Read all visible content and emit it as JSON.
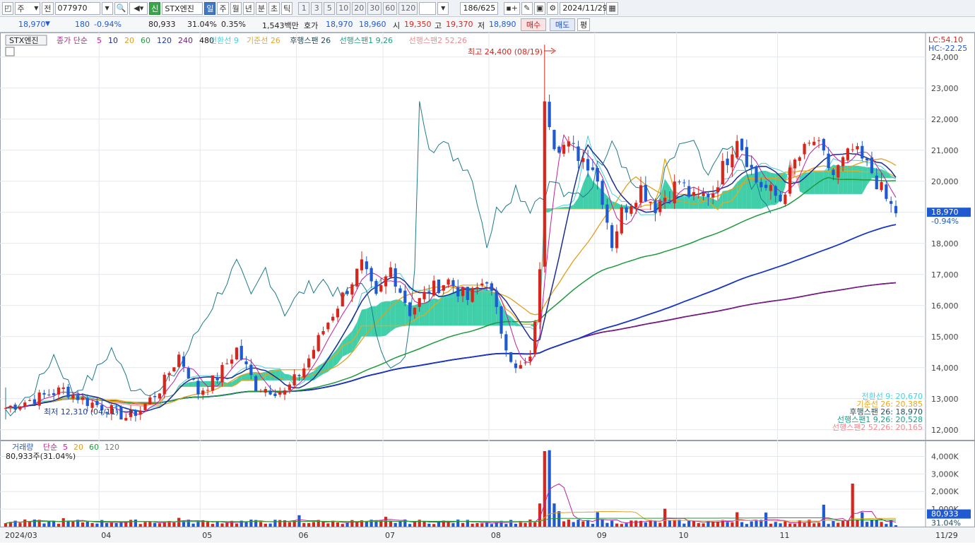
{
  "toolbar": {
    "type_select": "주",
    "prev_label": "전",
    "code": "077970",
    "name_badge": "신",
    "name": "STX엔진",
    "periods": [
      "일",
      "주",
      "월",
      "년",
      "분",
      "초",
      "틱"
    ],
    "active_period": "일",
    "intervals": [
      "1",
      "3",
      "5",
      "10",
      "20",
      "30",
      "60",
      "120"
    ],
    "count": "186/625",
    "date": "2024/11/29"
  },
  "quote": {
    "price": "18,970",
    "change": "180",
    "change_pct": "-0.94%",
    "volume": "80,933",
    "vol_ratio": "31.04%",
    "turnover": "0.35%",
    "amount": "1,543백만",
    "ask_label": "호가",
    "ask": "18,970",
    "bid": "18,960",
    "open_label": "시",
    "open": "19,350",
    "high_label": "고",
    "high": "19,370",
    "low_label": "저",
    "low": "18,890",
    "buy_label": "매수",
    "sell_label": "매도",
    "eval_label": "평"
  },
  "legend": {
    "name": "STX엔진",
    "ma": "종가 단순",
    "periods": [
      "5",
      "10",
      "20",
      "60",
      "120",
      "240",
      "480"
    ],
    "ichimoku": [
      "전환선 9",
      "기준선 26",
      "후행스팬 26",
      "선행스팬1 9,26",
      "선행스팬2 52,26"
    ],
    "volume": "거래량",
    "volume_ma": "단순",
    "volume_periods": [
      "5",
      "20",
      "60",
      "120"
    ],
    "volume_value": "80,933주(31.04%)"
  },
  "annotations": {
    "high": "최고 24,400 (08/19)",
    "low": "최저 12,310 (04/11)",
    "lc": "LC:54.10",
    "hc": "HC:-22.25",
    "price_tag": "18,970",
    "pct_tag": "-0.94%",
    "vol_tag": "80,933",
    "vol_pct_tag": "31.04%"
  },
  "ichimoku_values": [
    "전환선 9: 20,670",
    "기준선 26: 20,385",
    "후행스팬 26: 18,970",
    "선행스팬1 9,26: 20,528",
    "선행스팬2 52,26: 20,165"
  ],
  "colors": {
    "up": "#d8261d",
    "down": "#1f5ad1",
    "ma5": "#c0209e",
    "ma10": "#1d2d8f",
    "ma20": "#e0a01e",
    "ma60": "#1e9a3c",
    "ma120": "#1736c4",
    "ma240": "#7b1a8a",
    "ma480": "#111111",
    "conv": "#44d0e0",
    "base": "#e8a818",
    "lag": "#1e7a8a",
    "cloud_up": "#1ec79a",
    "cloud_down": "#f2a0a8"
  },
  "chart_data": {
    "type": "candlestick",
    "title": "STX엔진",
    "y_ticks": [
      "24,000",
      "23,000",
      "22,000",
      "21,000",
      "20,000",
      "19,000",
      "18,000",
      "17,000",
      "16,000",
      "15,000",
      "14,000",
      "13,000",
      "12,000"
    ],
    "ylim": [
      11700,
      24700
    ],
    "x_ticks": [
      {
        "label": "2024/03",
        "index": 0
      },
      {
        "label": "04",
        "index": 20
      },
      {
        "label": "05",
        "index": 41
      },
      {
        "label": "06",
        "index": 61
      },
      {
        "label": "07",
        "index": 79
      },
      {
        "label": "08",
        "index": 101
      },
      {
        "label": "09",
        "index": 123
      },
      {
        "label": "10",
        "index": 140
      },
      {
        "label": "11",
        "index": 161
      },
      {
        "label": "11/29",
        "index": 185
      }
    ],
    "volume_ticks": [
      "4,000K",
      "3,000K",
      "2,000K",
      "1,000K"
    ],
    "volume_ylim": [
      0,
      4500
    ],
    "waypoints": [
      [
        0,
        12700
      ],
      [
        6,
        13000
      ],
      [
        12,
        13300
      ],
      [
        17,
        12900
      ],
      [
        21,
        12700
      ],
      [
        25,
        12400
      ],
      [
        28,
        12650
      ],
      [
        32,
        13300
      ],
      [
        36,
        14400
      ],
      [
        40,
        13200
      ],
      [
        44,
        13700
      ],
      [
        48,
        14600
      ],
      [
        52,
        13400
      ],
      [
        58,
        13200
      ],
      [
        62,
        14000
      ],
      [
        66,
        15200
      ],
      [
        70,
        16300
      ],
      [
        74,
        17300
      ],
      [
        77,
        16200
      ],
      [
        80,
        17200
      ],
      [
        84,
        15800
      ],
      [
        88,
        16500
      ],
      [
        92,
        16800
      ],
      [
        96,
        16200
      ],
      [
        100,
        16900
      ],
      [
        103,
        15200
      ],
      [
        106,
        13900
      ],
      [
        109,
        14200
      ],
      [
        111,
        17000
      ],
      [
        112,
        22800
      ],
      [
        114,
        21300
      ],
      [
        118,
        21000
      ],
      [
        122,
        20500
      ],
      [
        124,
        19500
      ],
      [
        126,
        18000
      ],
      [
        128,
        19000
      ],
      [
        132,
        19800
      ],
      [
        135,
        19200
      ],
      [
        140,
        20000
      ],
      [
        143,
        19400
      ],
      [
        147,
        19700
      ],
      [
        152,
        21500
      ],
      [
        156,
        20000
      ],
      [
        161,
        19400
      ],
      [
        164,
        20600
      ],
      [
        168,
        21300
      ],
      [
        172,
        20200
      ],
      [
        176,
        21000
      ],
      [
        180,
        20300
      ],
      [
        183,
        19400
      ],
      [
        185,
        18970
      ]
    ],
    "volume_spikes": [
      [
        12,
        480
      ],
      [
        36,
        500
      ],
      [
        61,
        650
      ],
      [
        79,
        560
      ],
      [
        111,
        1320
      ],
      [
        112,
        4300
      ],
      [
        113,
        4350
      ],
      [
        114,
        1320
      ],
      [
        115,
        880
      ],
      [
        123,
        820
      ],
      [
        137,
        1020
      ],
      [
        152,
        820
      ],
      [
        158,
        800
      ],
      [
        170,
        1250
      ],
      [
        176,
        2450
      ],
      [
        178,
        820
      ]
    ],
    "ichimoku_last": {
      "conversion": 20670,
      "base": 20385,
      "lagging": 18970,
      "span1": 20528,
      "span2": 20165
    },
    "extremes": {
      "high": 24400,
      "high_date": "08/19",
      "low": 12310,
      "low_date": "04/11"
    }
  }
}
